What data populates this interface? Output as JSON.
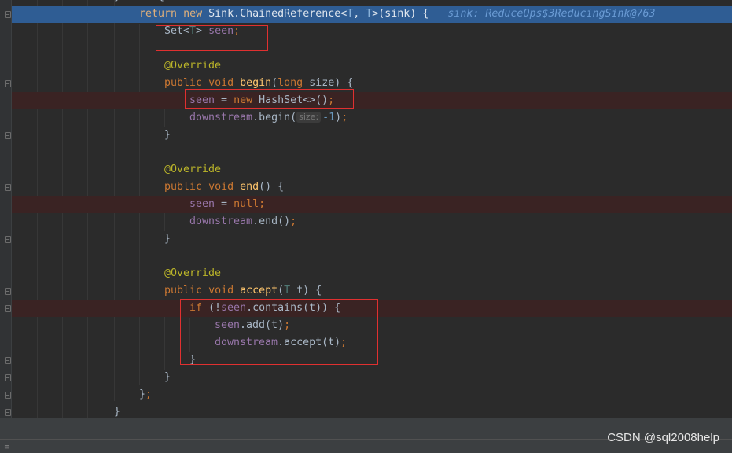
{
  "line1": {
    "return_kw": "return",
    "new_kw": "new",
    "class_before": "Sink.ChainedReference<",
    "type_t1": "T",
    "comma": ", ",
    "type_t2": "T",
    "close": ">(sink) {",
    "debug_value": "sink: ReduceOps$3ReducingSink@763"
  },
  "line2": {
    "type_start": "Set<",
    "type_t": "T",
    "type_end": "> ",
    "field": "seen",
    "semi": ";"
  },
  "line4": {
    "annotation": "@Override"
  },
  "line5": {
    "public_kw": "public",
    "void_kw": "void",
    "method": "begin",
    "open": "(",
    "long_kw": "long",
    "rest": " size) {"
  },
  "line6": {
    "field": "seen",
    "eq": " = ",
    "new_kw": "new",
    "rest": " HashSet<>()",
    "semi": ";"
  },
  "line7": {
    "field": "downstream",
    "call": ".begin(",
    "hint": "size:",
    "num": "-1",
    "close": ")",
    "semi": ";"
  },
  "line8": {
    "brace": "}"
  },
  "line10": {
    "annotation": "@Override"
  },
  "line11": {
    "public_kw": "public",
    "void_kw": "void",
    "method": "end",
    "rest": "() {"
  },
  "line12": {
    "field": "seen",
    "eq": " = ",
    "null_kw": "null",
    "semi": ";"
  },
  "line13": {
    "field": "downstream",
    "call": ".end()",
    "semi": ";"
  },
  "line14": {
    "brace": "}"
  },
  "line16": {
    "annotation": "@Override"
  },
  "line17": {
    "public_kw": "public",
    "void_kw": "void",
    "method": "accept",
    "open": "(",
    "type_t": "T",
    "rest": " t) {"
  },
  "line18": {
    "if_kw": "if",
    "open": " (!",
    "field": "seen",
    "rest": ".contains(t)) {"
  },
  "line19": {
    "field": "seen",
    "call": ".add(t)",
    "semi": ";"
  },
  "line20": {
    "field": "downstream",
    "call": ".accept(t)",
    "semi": ";"
  },
  "line21": {
    "brace": "}"
  },
  "line22": {
    "brace": "}"
  },
  "line23": {
    "brace": "}",
    "semi": ";"
  },
  "line24": {
    "brace": "}"
  },
  "watermark": "CSDN @sql2008help"
}
